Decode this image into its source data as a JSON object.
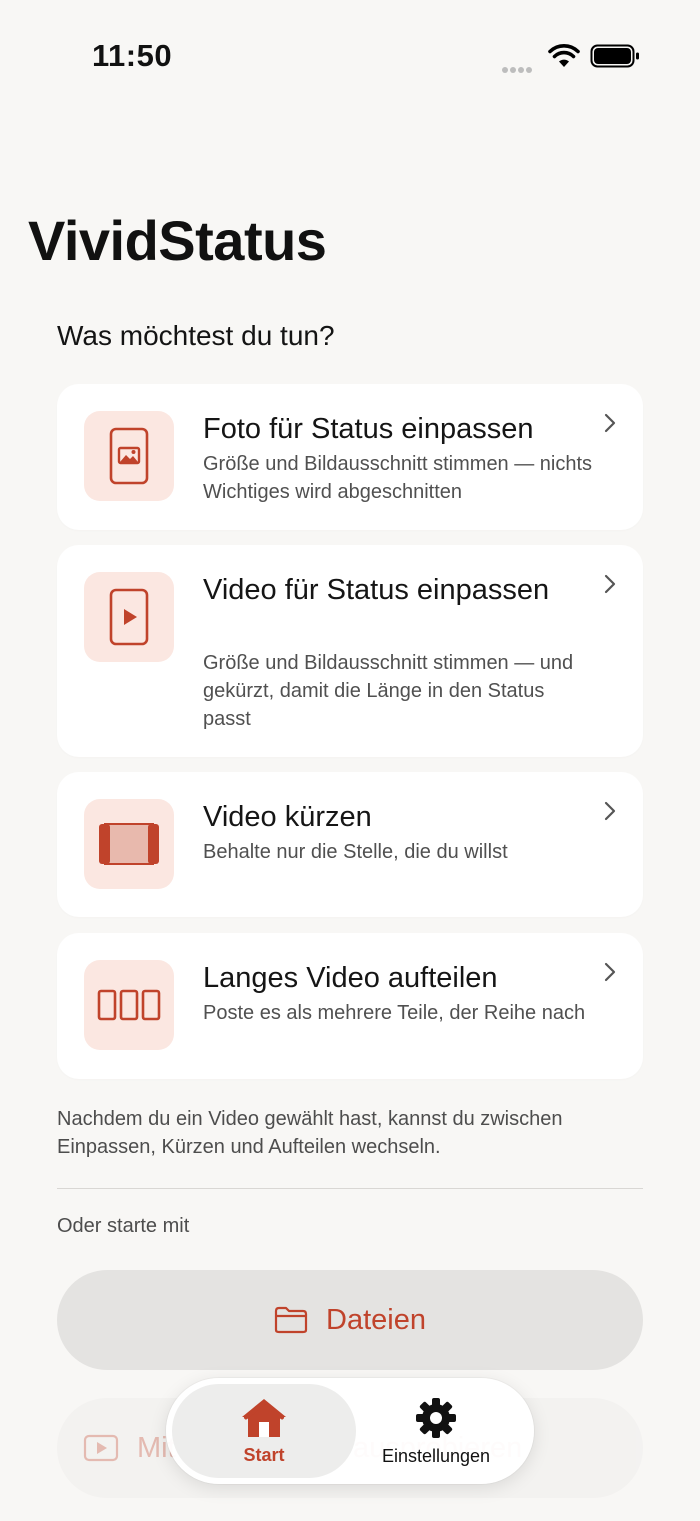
{
  "status_bar": {
    "time": "11:50"
  },
  "app": {
    "title": "VividStatus"
  },
  "main": {
    "heading": "Was möchtest du tun?",
    "cards": [
      {
        "title": "Foto für Status einpassen",
        "description": "Größe und Bildausschnitt stimmen — nichts Wichtiges wird abgeschnitten",
        "icon": "photo-portrait-icon"
      },
      {
        "title": "Video für Status einpassen",
        "description": "Größe und Bildausschnitt stimmen — und gekürzt, damit die Länge in den Status passt",
        "icon": "video-portrait-icon"
      },
      {
        "title": "Video kürzen",
        "description": "Behalte nur die Stelle, die du willst",
        "icon": "trim-icon"
      },
      {
        "title": "Langes Video aufteilen",
        "description": "Poste es als mehrere Teile, der Reihe nach",
        "icon": "split-icon"
      }
    ],
    "info_text": "Nachdem du ein Video gewählt hast, kannst du zwischen Einpassen, Kürzen und Aufteilen wechseln.",
    "subheading": "Oder starte mit",
    "files_button_label": "Dateien",
    "second_button_label": "Mit Beispiel-Clip ausprobieren"
  },
  "tab_bar": {
    "tabs": [
      {
        "label": "Start",
        "icon": "house-icon",
        "selected": true
      },
      {
        "label": "Einstellungen",
        "icon": "gear-icon",
        "selected": false
      }
    ]
  },
  "colors": {
    "accent": "#c0432b",
    "icon_bg": "#fbe7e1",
    "background": "#f8f7f5",
    "card": "#ffffff"
  }
}
